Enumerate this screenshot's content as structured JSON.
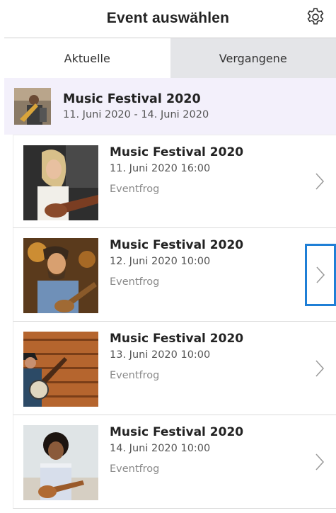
{
  "header": {
    "title": "Event auswählen",
    "settings_icon": "gear-icon"
  },
  "tabs": [
    {
      "label": "Aktuelle",
      "selected": true
    },
    {
      "label": "Vergangene",
      "selected": false
    }
  ],
  "event": {
    "title": "Music Festival 2020",
    "dates": "11. Juni 2020 - 14. Juni 2020"
  },
  "sessions": [
    {
      "title": "Music Festival 2020",
      "datetime": "11. Juni 2020 16:00",
      "organizer": "Eventfrog"
    },
    {
      "title": "Music Festival 2020",
      "datetime": "12. Juni 2020 10:00",
      "organizer": "Eventfrog"
    },
    {
      "title": "Music Festival 2020",
      "datetime": "13. Juni 2020 10:00",
      "organizer": "Eventfrog"
    },
    {
      "title": "Music Festival 2020",
      "datetime": "14. Juni 2020 10:00",
      "organizer": "Eventfrog"
    }
  ],
  "colors": {
    "accent": "#1f7fd6",
    "event_header_bg": "#f3f0fb",
    "inactive_tab_bg": "#e4e5e8"
  }
}
